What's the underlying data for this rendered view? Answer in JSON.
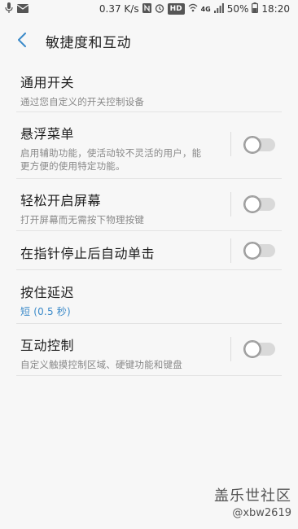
{
  "status_bar": {
    "speed": "0.37 K/s",
    "hd_badge": "HD",
    "network": "4G",
    "battery": "50%",
    "time": "18:20"
  },
  "header": {
    "title": "敏捷度和互动"
  },
  "items": [
    {
      "title": "通用开关",
      "subtitle": "通过您自定义的开关控制设备",
      "has_toggle": false
    },
    {
      "title": "悬浮菜单",
      "subtitle": "启用辅助功能，使活动较不灵活的用户，能更方便的使用特定功能。",
      "has_toggle": true,
      "enabled": false
    },
    {
      "title": "轻松开启屏幕",
      "subtitle": "打开屏幕而无需按下物理按键",
      "has_toggle": true,
      "enabled": false
    },
    {
      "title": "在指针停止后自动单击",
      "subtitle": "",
      "has_toggle": true,
      "enabled": false
    },
    {
      "title": "按住延迟",
      "subtitle": "短 (0.5 秒)",
      "has_toggle": false
    },
    {
      "title": "互动控制",
      "subtitle": "自定义触摸控制区域、硬键功能和键盘",
      "has_toggle": true,
      "enabled": false
    }
  ],
  "watermark": {
    "main": "盖乐世社区",
    "sub": "@xbw2619"
  },
  "colors": {
    "accent": "#3b8ac9",
    "background": "#f7f7f7",
    "toggle_off_track": "#d9d9d9"
  }
}
